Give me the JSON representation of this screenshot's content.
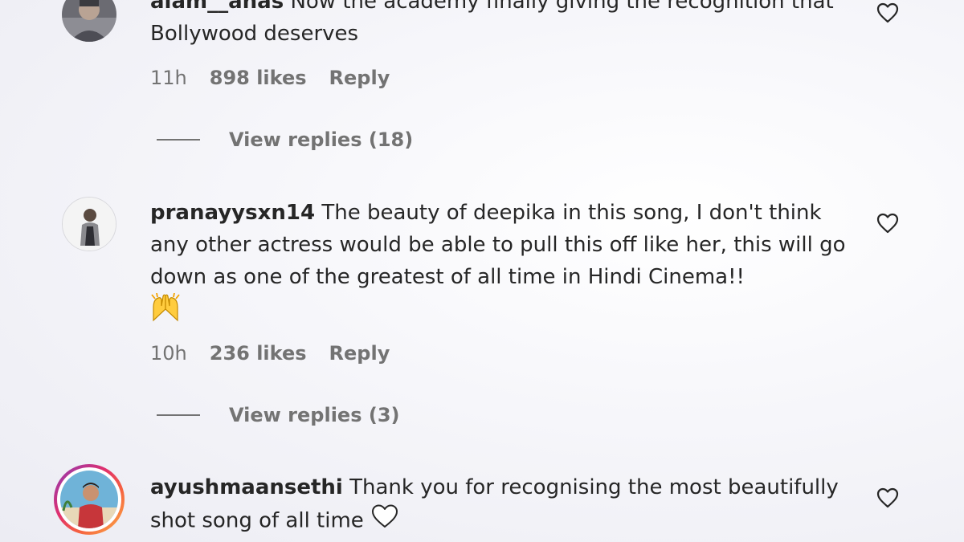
{
  "comments": [
    {
      "username": "alam__anas",
      "text": "Now the academy finally giving the recognition that Bollywood deserves",
      "time": "11h",
      "likes": "898 likes",
      "reply_label": "Reply",
      "view_replies": "View replies (18)"
    },
    {
      "username": "pranayysxn14",
      "text": "The beauty of deepika in this song, I don't think any other actress would be able to pull this off like her, this will go down as one of the greatest of all time in Hindi Cinema!!",
      "emoji": "raising-hands-emoji",
      "time": "10h",
      "likes": "236 likes",
      "reply_label": "Reply",
      "view_replies": "View replies (3)"
    },
    {
      "username": "ayushmaansethi",
      "text": "Thank you for recognising the most beautifully shot song of all time",
      "emoji": "white-heart-emoji"
    }
  ],
  "colors": {
    "text": "#262626",
    "secondary": "#737373",
    "story_ring_start": "#8a3ab9",
    "story_ring_end": "#fcaf45"
  }
}
